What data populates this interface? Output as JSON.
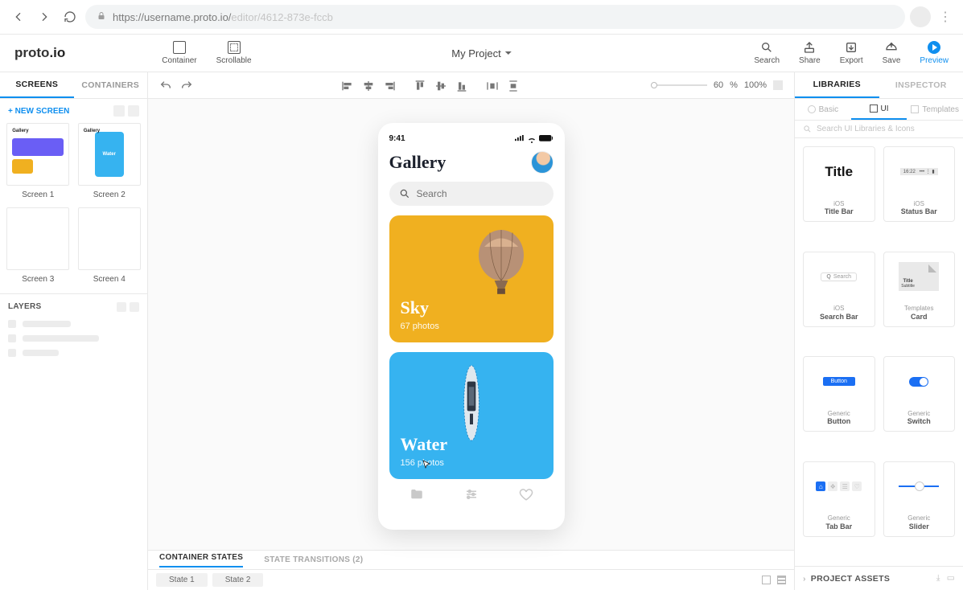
{
  "browser": {
    "url_locked": "https://username.proto.io/",
    "url_rest": "editor/4612-873e-fccb"
  },
  "app": {
    "logo": "proto.io",
    "insert": {
      "container": "Container",
      "scrollable": "Scrollable"
    },
    "project_title": "My Project",
    "actions": {
      "search": "Search",
      "share": "Share",
      "export": "Export",
      "save": "Save",
      "preview": "Preview"
    }
  },
  "toolbar": {
    "zoom_value": "60",
    "zoom_unit": "%",
    "zoom_display": "100%"
  },
  "left_panel": {
    "tabs": {
      "screens": "SCREENS",
      "containers": "CONTAINERS"
    },
    "new_screen": "+ NEW SCREEN",
    "screens": [
      "Screen 1",
      "Screen 2",
      "Screen 3",
      "Screen 4"
    ],
    "layers_title": "LAYERS"
  },
  "canvas": {
    "status_time": "9:41",
    "screen_title": "Gallery",
    "search_placeholder": "Search",
    "cards": [
      {
        "title": "Sky",
        "subtitle": "67 photos"
      },
      {
        "title": "Water",
        "subtitle": "156 photos"
      }
    ],
    "footer": {
      "tabs": {
        "states": "CONTAINER STATES",
        "transitions": "STATE TRANSITIONS (2)"
      },
      "states": [
        "State 1",
        "State 2"
      ]
    }
  },
  "right_panel": {
    "tabs": {
      "libraries": "LIBRARIES",
      "inspector": "INSPECTOR"
    },
    "filters": {
      "basic": "Basic",
      "ui": "UI",
      "templates": "Templates"
    },
    "search": "Search UI Libraries & Icons",
    "library": [
      {
        "sub": "",
        "name": "Title Bar",
        "preview": "Title"
      },
      {
        "sub": "iOS",
        "name": "Status Bar",
        "preview": "16:22"
      },
      {
        "sub": "iOS",
        "name": "Title Bar"
      },
      {
        "sub": "iOS",
        "name": "Status Bar"
      },
      {
        "sub": "iOS",
        "name": "Search Bar"
      },
      {
        "sub": "Templates",
        "name": "Card"
      },
      {
        "sub": "Generic",
        "name": "Button"
      },
      {
        "sub": "Generic",
        "name": "Switch"
      },
      {
        "sub": "Generic",
        "name": "Tab Bar"
      },
      {
        "sub": "Generic",
        "name": "Slider"
      }
    ],
    "assets_title": "PROJECT ASSETS"
  }
}
